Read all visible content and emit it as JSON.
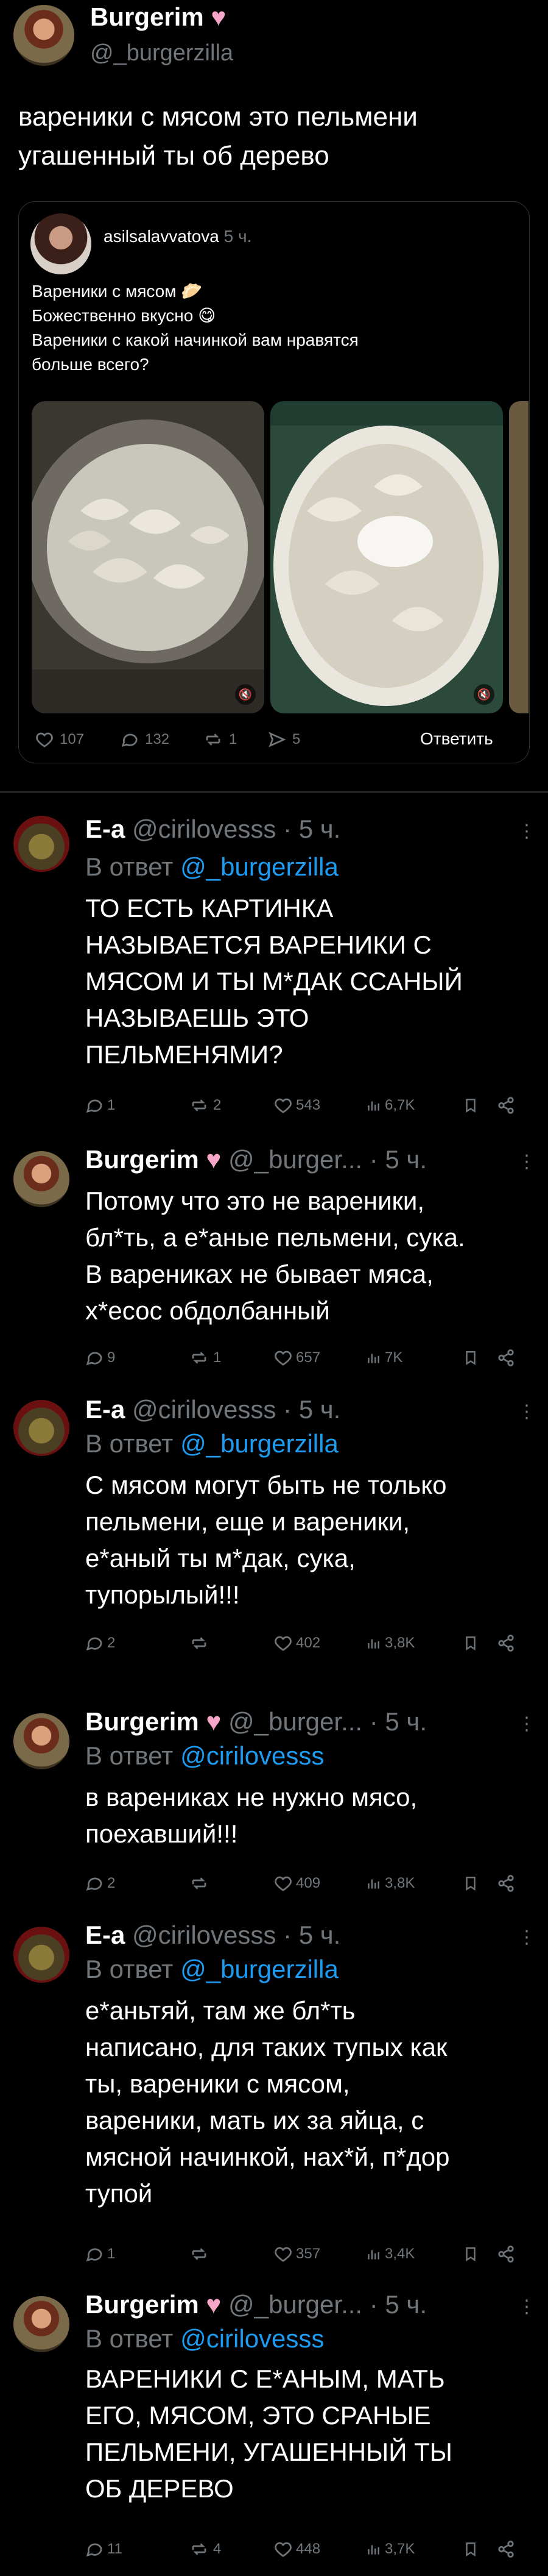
{
  "main_tweet": {
    "display_name": "Burgerim",
    "handle": "@_burgerzilla",
    "text_line1": "вареники с мясом это пельмени",
    "text_line2": "угашенный ты об дерево"
  },
  "quoted_post": {
    "username": "asilsalavvatova",
    "time": "5 ч.",
    "lines": [
      "Вареники с мясом 🥟",
      "Божественно вкусно 😋",
      "Вареники с какой начинкой вам нравятся",
      "больше всего?"
    ],
    "stats": {
      "comments": "107",
      "replies": "132",
      "reposts": "1",
      "shares": "5"
    },
    "reply_button": "Ответить"
  },
  "replies": [
    {
      "name": "E-a",
      "handle": "@cirilovesss",
      "time": "· 5 ч.",
      "reply_prefix": "В ответ",
      "reply_to": "@_burgerzilla",
      "lines": [
        "ТО ЕСТЬ КАРТИНКА",
        "НАЗЫВАЕТСЯ ВАРЕНИКИ С",
        "МЯСОМ И ТЫ М*ДАК ССАНЫЙ",
        "НАЗЫВАЕШЬ ЭТО",
        "ПЕЛЬМЕНЯМИ?"
      ],
      "stats": {
        "replies": "1",
        "reposts": "2",
        "likes": "543",
        "views": "6,7K"
      }
    },
    {
      "name": "Burgerim",
      "handle": "@_burger...",
      "time": "· 5 ч.",
      "lines": [
        "Потому что это не вареники,",
        "бл*ть, а е*аные пельмени, сука.",
        "В варениках не бывает мяса,",
        "х*есос обдолбанный"
      ],
      "stats": {
        "replies": "9",
        "reposts": "1",
        "likes": "657",
        "views": "7K"
      }
    },
    {
      "name": "E-a",
      "handle": "@cirilovesss",
      "time": "· 5 ч.",
      "reply_prefix": "В ответ",
      "reply_to": "@_burgerzilla",
      "lines": [
        "С мясом могут быть не только",
        "пельмени, еще и вареники,",
        "е*аный ты м*дак, сука,",
        "тупорылый!!!"
      ],
      "stats": {
        "replies": "2",
        "reposts": "",
        "likes": "402",
        "views": "3,8K"
      }
    },
    {
      "name": "Burgerim",
      "handle": "@_burger...",
      "time": "· 5 ч.",
      "reply_prefix": "В ответ",
      "reply_to": "@cirilovesss",
      "lines": [
        "в варениках не нужно мясо,",
        "поехавший!!!"
      ],
      "stats": {
        "replies": "2",
        "reposts": "",
        "likes": "409",
        "views": "3,8K"
      }
    },
    {
      "name": "E-a",
      "handle": "@cirilovesss",
      "time": "· 5 ч.",
      "reply_prefix": "В ответ",
      "reply_to": "@_burgerzilla",
      "lines": [
        "е*аньтяй, там же бл*ть",
        "написано, для таких тупых как",
        "ты, вареники с мясом,",
        "вареники, мать их за яйца, с",
        "мясной начинкой, нах*й, п*дор",
        "тупой"
      ],
      "stats": {
        "replies": "1",
        "reposts": "",
        "likes": "357",
        "views": "3,4K"
      }
    },
    {
      "name": "Burgerim",
      "handle": "@_burger...",
      "time": "· 5 ч.",
      "reply_prefix": "В ответ",
      "reply_to": "@cirilovesss",
      "lines": [
        "ВАРЕНИКИ С Е*АНЫМ, МАТЬ",
        "ЕГО, МЯСОМ, ЭТО СРАНЫЕ",
        "ПЕЛЬМЕНИ, УГАШЕННЫЙ ТЫ",
        "ОБ ДЕРЕВО"
      ],
      "stats": {
        "replies": "11",
        "reposts": "4",
        "likes": "448",
        "views": "3,7K"
      }
    }
  ],
  "colors": {
    "background": "#000000",
    "text": "#e7e9ea",
    "muted": "#71767b",
    "link": "#1d9bf0",
    "heart": "#f7a6c8"
  }
}
